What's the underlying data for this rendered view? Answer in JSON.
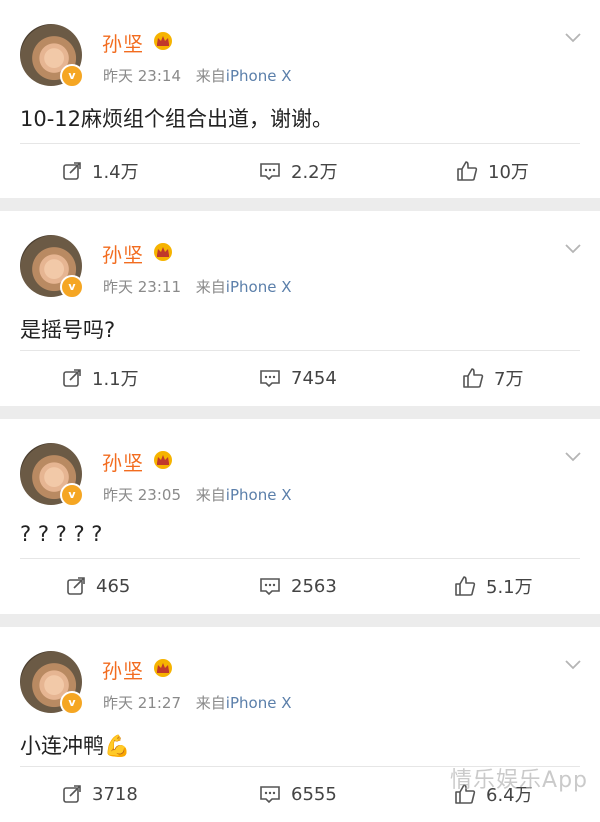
{
  "colors": {
    "name": "#f26c1f",
    "source": "#5b7faa",
    "meta": "#8a8a8a",
    "badge": "#f5a623"
  },
  "posts": [
    {
      "author": "孙坚",
      "time": "昨天 23:14",
      "source_prefix": "来自",
      "source": "iPhone X",
      "text": "10-12麻烦组个组合出道，谢谢。",
      "repost": "1.4万",
      "comment": "2.2万",
      "like": "10万"
    },
    {
      "author": "孙坚",
      "time": "昨天 23:11",
      "source_prefix": "来自",
      "source": "iPhone X",
      "text": "是摇号吗?",
      "repost": "1.1万",
      "comment": "7454",
      "like": "7万"
    },
    {
      "author": "孙坚",
      "time": "昨天 23:05",
      "source_prefix": "来自",
      "source": "iPhone X",
      "text": "? ? ? ? ?",
      "repost": "465",
      "comment": "2563",
      "like": "5.1万"
    },
    {
      "author": "孙坚",
      "time": "昨天 21:27",
      "source_prefix": "来自",
      "source": "iPhone X",
      "text": "小连冲鸭💪",
      "repost": "3718",
      "comment": "6555",
      "like": "6.4万"
    }
  ],
  "watermark": "情乐娱乐App",
  "icons": [
    "crown-icon",
    "verified-badge-icon",
    "chevron-down-icon",
    "repost-icon",
    "comment-icon",
    "like-icon"
  ]
}
